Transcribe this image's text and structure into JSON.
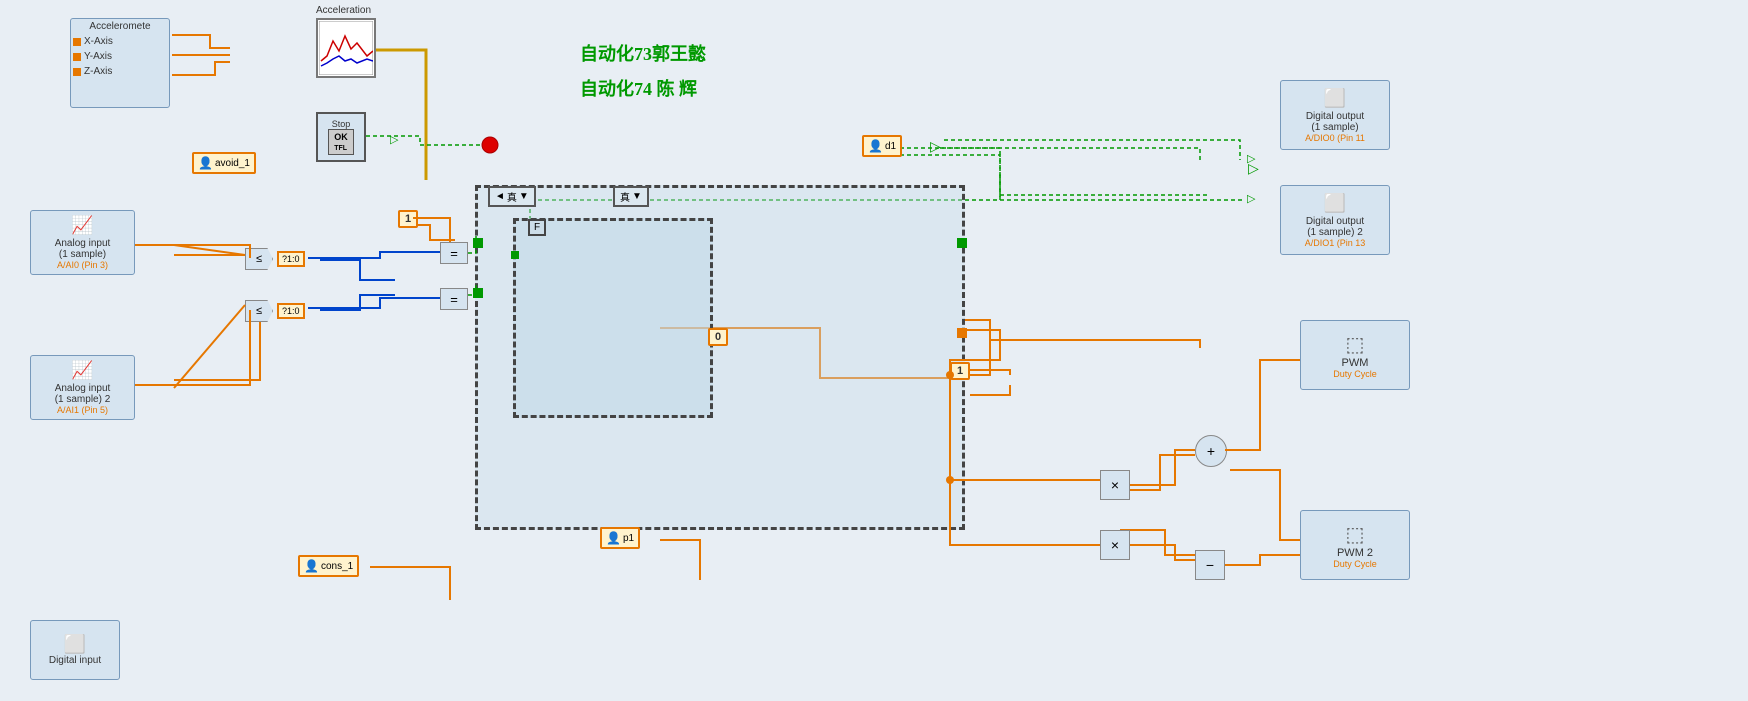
{
  "canvas": {
    "bg": "#e8eef4"
  },
  "annotation": {
    "line1": "自动化73郭王懿",
    "line2": "自动化74 陈  辉"
  },
  "blocks": {
    "accelerometer": {
      "title": "Acceleromete",
      "rows": [
        "X-Axis",
        "Y-Axis",
        "Z-Axis"
      ]
    },
    "acceleration_chart": {
      "title": "Acceleration"
    },
    "stop": {
      "label": "Stop",
      "inner": "OK"
    },
    "avoid1": {
      "label": "avoid_1"
    },
    "analog1": {
      "line1": "Analog input",
      "line2": "(1 sample)",
      "pin": "A/AI0 (Pin 3)"
    },
    "analog2": {
      "line1": "Analog input",
      "line2": "(1 sample) 2",
      "pin": "A/AI1 (Pin 5)"
    },
    "dout1": {
      "line1": "Digital output",
      "line2": "(1 sample)",
      "pin": "A/DIO0 (Pin 11"
    },
    "dout2": {
      "line1": "Digital output",
      "line2": "(1 sample) 2",
      "pin": "A/DIO1 (Pin 13"
    },
    "pwm1": {
      "line1": "PWM",
      "pin": "Duty Cycle"
    },
    "pwm2": {
      "line1": "PWM 2",
      "pin": "Duty Cycle"
    },
    "din": {
      "label": "Digital input"
    },
    "d1": {
      "label": "d1"
    },
    "p1": {
      "label": "p1"
    },
    "cons1": {
      "label": "cons_1"
    },
    "const0": {
      "value": "0"
    },
    "const1a": {
      "value": "1"
    },
    "const1b": {
      "value": "1"
    },
    "case_selector1": {
      "label": "真"
    },
    "case_selector2": {
      "label": "真"
    },
    "inner_case_label": {
      "label": "F"
    }
  },
  "operators": {
    "compare1": "≤",
    "compare2": "≤",
    "equal1": "=",
    "add": "+",
    "mult1": "×",
    "mult2": "×",
    "sub": "-",
    "p21o": "?1:0"
  }
}
